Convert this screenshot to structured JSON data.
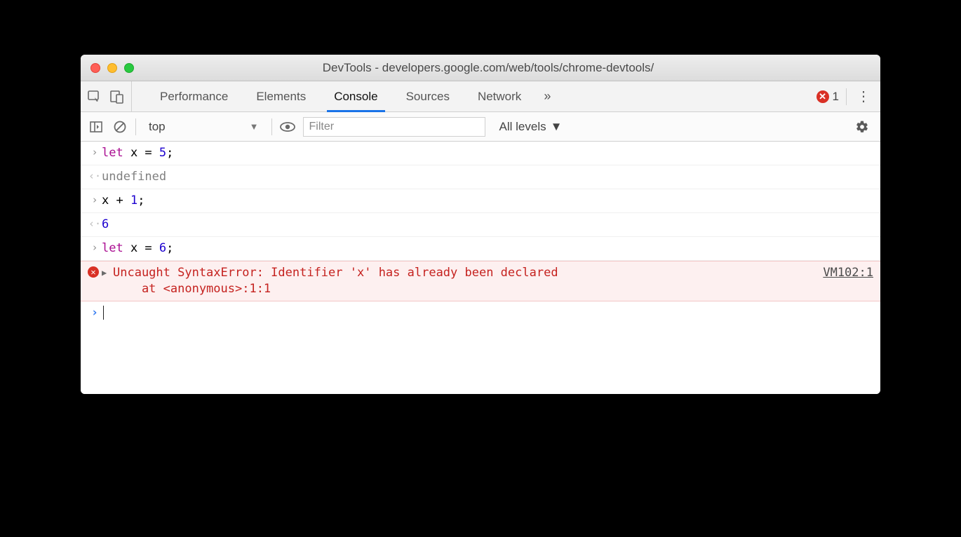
{
  "window": {
    "app": "DevTools",
    "url": "developers.google.com/web/tools/chrome-devtools/"
  },
  "toolbar": {
    "tabs": [
      "Performance",
      "Elements",
      "Console",
      "Sources",
      "Network"
    ],
    "active_tab": "Console",
    "more": "»",
    "error_count": "1"
  },
  "subtoolbar": {
    "context": "top",
    "filter_placeholder": "Filter",
    "levels": "All levels"
  },
  "console": {
    "entries": [
      {
        "type": "input",
        "code": [
          {
            "t": "let ",
            "c": "kw"
          },
          {
            "t": "x = "
          },
          {
            "t": "5",
            "c": "num"
          },
          {
            "t": ";"
          }
        ]
      },
      {
        "type": "output",
        "text": "undefined",
        "c": "undef"
      },
      {
        "type": "input",
        "code": [
          {
            "t": "x + "
          },
          {
            "t": "1",
            "c": "num"
          },
          {
            "t": ";"
          }
        ]
      },
      {
        "type": "output",
        "text": "6",
        "c": "num"
      },
      {
        "type": "input",
        "code": [
          {
            "t": "let ",
            "c": "kw"
          },
          {
            "t": "x = "
          },
          {
            "t": "6",
            "c": "num"
          },
          {
            "t": ";"
          }
        ]
      },
      {
        "type": "error",
        "message": "Uncaught SyntaxError: Identifier 'x' has already been declared\n    at <anonymous>:1:1",
        "source": "VM102:1"
      }
    ]
  }
}
